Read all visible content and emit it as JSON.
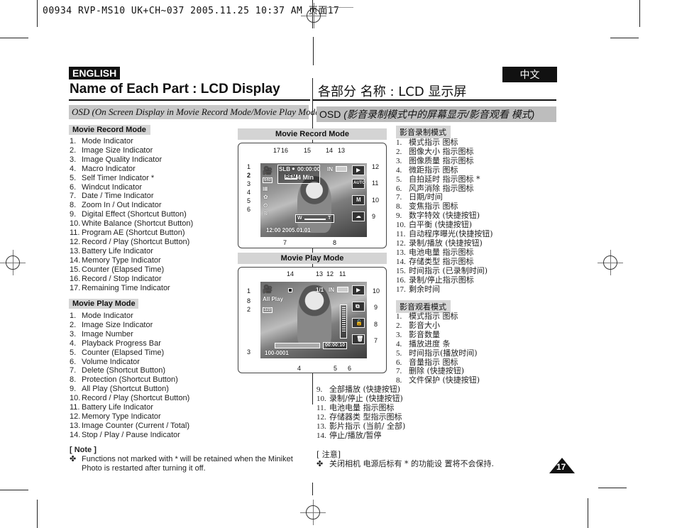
{
  "print_header": {
    "text": "00934 RVP-MS10 UK+CH~037  2005.11.25 10:37 AM  页面17"
  },
  "english": {
    "lang_badge": "ENGLISH",
    "title": "Name of Each Part : LCD Display",
    "section": "OSD (On Screen Display in Movie Record Mode/Movie Play Mode)",
    "record_mode": {
      "heading": "Movie Record Mode",
      "items": [
        "Mode Indicator",
        "Image Size Indicator",
        "Image Quality Indicator",
        "Macro Indicator",
        "Self Timer Indicator *",
        "Windcut Indicator",
        "Date / Time Indicator",
        "Zoom In / Out Indicator",
        "Digital Effect (Shortcut Button)",
        "White Balance (Shortcut Button)",
        "Program AE (Shortcut Button)",
        "Record / Play (Shortcut Button)",
        "Battery Life Indicator",
        "Memory Type Indicator",
        "Counter (Elapsed Time)",
        "Record / Stop Indicator",
        "Remaining Time Indicator"
      ]
    },
    "play_mode": {
      "heading": "Movie Play Mode",
      "items": [
        "Mode Indicator",
        "Image Size Indicator",
        "Image Number",
        "Playback Progress Bar",
        "Counter (Elapsed Time)",
        "Volume Indicator",
        "Delete (Shortcut Button)",
        "Protection (Shortcut Button)",
        "All Play (Shortcut Button)",
        "Record / Play (Shortcut Button)",
        "Battery Life Indicator",
        "Memory Type Indicator",
        "Image Counter (Current / Total)",
        "Stop / Play / Pause Indicator"
      ]
    },
    "note": {
      "title": "[ Note ]",
      "bullet": "✤",
      "text_line1": "Functions not marked with * will be retained when the Miniket",
      "text_line2": "Photo is restarted after turning it off."
    }
  },
  "chinese": {
    "lang_badge": "中文",
    "title": "各部分 名称 : LCD 显示屏",
    "section_osd": "OSD ",
    "section_rest": "(影音录制模式中的屏幕显示/影音观看 模式)",
    "record_mode": {
      "heading": "影音录制模式",
      "items": [
        "模式指示 图标",
        "图像大小 指示图标",
        "图像质量 指示图标",
        "微距指示 图标",
        "自拍延时 指示图标 *",
        "风声消除 指示图标",
        "日期/时间",
        "变焦指示 图标",
        "数字特效 (快捷按钮)",
        "白平衡 (快捷按钮)",
        "自动程序曝光(快捷按钮)",
        "录制/播放 (快捷按钮)",
        "电池电量 指示图标",
        "存储类型 指示图标",
        "时间指示 (已录制时间)",
        "录制/停止指示图标",
        "剩余时间"
      ]
    },
    "play_mode": {
      "heading": "影音观看模式",
      "items": [
        "模式指示 图标",
        "影音大小",
        "影音数量",
        "播放进度 条",
        "时间指示(播放时间)",
        "音量指示 图标",
        "删除 (快捷按钮)",
        "文件保护 (快捷按钮)",
        "全部播放 (快捷按钮)",
        "录制/停止 (快捷按钮)",
        "电池电量 指示图标",
        "存储器类 型指示图标",
        "影片指示 (当前/ 全部)",
        "停止/播放/暂停"
      ]
    },
    "note": {
      "title": "[ 注意]",
      "bullet": "✤",
      "text": "关闭相机 电源后标有 * 的功能设 置将不会保持."
    }
  },
  "diagram_record": {
    "title": "Movie Record Mode",
    "callouts_top": [
      "17",
      "16",
      "15",
      "14",
      "13"
    ],
    "callouts_left": [
      "1",
      "2",
      "3",
      "4",
      "5",
      "6"
    ],
    "callouts_right": [
      "12",
      "11",
      "10",
      "9"
    ],
    "callouts_bottom": [
      "7",
      "8"
    ],
    "osd": {
      "quality": "SLB",
      "counter": "00:00:00",
      "rem_label": "REM",
      "remaining": "4 Min",
      "memory": "IN",
      "size": "640",
      "datetime": "12:00  2005.01.01",
      "zoom_w": "W",
      "zoom_t": "T",
      "ae": "AUTO"
    }
  },
  "diagram_play": {
    "title": "Movie Play Mode",
    "callouts_top": [
      "14",
      "13",
      "12",
      "11"
    ],
    "callouts_left": [
      "1",
      "8",
      "2",
      "3"
    ],
    "callouts_right": [
      "10",
      "9",
      "8",
      "7"
    ],
    "callouts_bottom": [
      "4",
      "5",
      "6"
    ],
    "osd": {
      "all_play": "All Play",
      "size": "320",
      "image_counter": "1/1",
      "memory": "IN",
      "image_number": "100-0001",
      "counter": "00:00:10",
      "progress": 0
    }
  },
  "page_number": "17"
}
